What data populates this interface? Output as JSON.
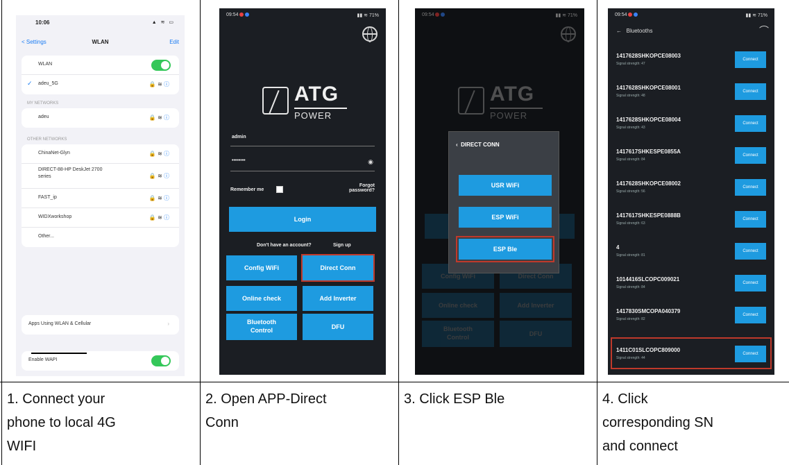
{
  "captions": [
    [
      "1. Connect your",
      "phone to local 4G",
      "WIFI"
    ],
    [
      "2. Open APP-Direct",
      "Conn"
    ],
    [
      "3. Click ESP Ble"
    ],
    [
      "4. Click",
      "corresponding SN",
      "and connect"
    ]
  ],
  "phone1": {
    "time": "10:06",
    "status_icons": "▲ ≋ ▭",
    "back": "< Settings",
    "title": "WLAN",
    "edit": "Edit",
    "wlan_label": "WLAN",
    "connected": "adeu_5G",
    "my_networks_header": "MY NETWORKS",
    "my_networks": [
      "adeu"
    ],
    "other_networks_header": "OTHER NETWORKS",
    "other_networks": [
      "ChinaNet-Glyn",
      "DIRECT-88-HP DeskJet 2700 series",
      "FAST_ip",
      "WIDXworkshop",
      "Other..."
    ],
    "apps_using": "Apps Using WLAN & Cellular",
    "enable_wapi": "Enable WAPI"
  },
  "phone2": {
    "status_left": "09:54",
    "status_right": "▮▮ ≋ 71%",
    "brand": "ATG",
    "brand_sub": "POWER",
    "username": "admin",
    "password_mask": "••••••••",
    "remember": "Remember me",
    "forgot": "Forgot password?",
    "login": "Login",
    "no_account": "Don't have an account?",
    "signup": "Sign up",
    "buttons": [
      "Config WiFi",
      "Direct Conn",
      "Online check",
      "Add Inverter",
      "Bluetooth Control",
      "DFU"
    ]
  },
  "phone3": {
    "dialog_title": "DIRECT CONN",
    "options": [
      "USR WiFi",
      "ESP WiFi",
      "ESP Ble"
    ]
  },
  "phone4": {
    "title": "Bluetooths",
    "connect": "Connect",
    "devices": [
      {
        "sn": "1417628SHKOPCE08003",
        "signal": "Signal strength: 47"
      },
      {
        "sn": "1417628SHKOPCE08001",
        "signal": "Signal strength: 48"
      },
      {
        "sn": "1417628SHKOPCE08004",
        "signal": "Signal strength: 43"
      },
      {
        "sn": "1417617SHKESPE0855A",
        "signal": "Signal strength: 84"
      },
      {
        "sn": "1417628SHKOPCE08002",
        "signal": "Signal strength: 56"
      },
      {
        "sn": "1417617SHKESPE0888B",
        "signal": "Signal strength: 63"
      },
      {
        "sn": "4",
        "signal": "Signal strength: 81"
      },
      {
        "sn": "1014416SLCOPC009021",
        "signal": "Signal strength: 84"
      },
      {
        "sn": "1417830SMCOPA040379",
        "signal": "Signal strength: 82"
      },
      {
        "sn": "1411C01SLCOPC809000",
        "signal": "Signal strength: 44"
      }
    ]
  }
}
